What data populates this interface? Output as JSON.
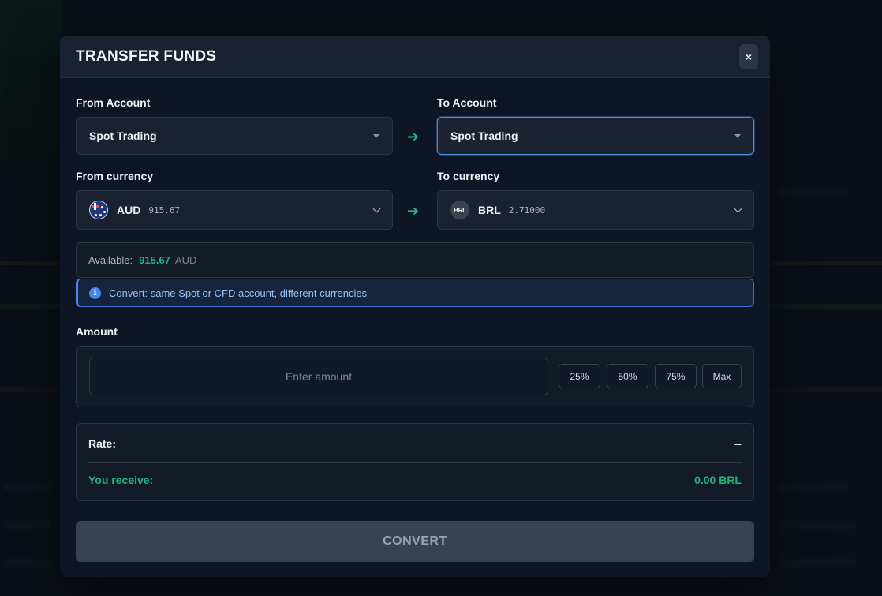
{
  "modal": {
    "title": "TRANSFER FUNDS",
    "close_label": "×"
  },
  "from_account": {
    "label": "From Account",
    "value": "Spot Trading"
  },
  "to_account": {
    "label": "To Account",
    "value": "Spot Trading"
  },
  "from_currency": {
    "label": "From currency",
    "code": "AUD",
    "balance": "915.67",
    "icon": "australia-flag-icon"
  },
  "to_currency": {
    "label": "To currency",
    "code": "BRL",
    "badge": "BRL",
    "balance": "2.71000",
    "icon": "brl-badge-icon"
  },
  "available": {
    "label": "Available:",
    "value": "915.67",
    "currency": "AUD"
  },
  "info": {
    "text": "Convert: same Spot or CFD account, different currencies"
  },
  "amount": {
    "label": "Amount",
    "placeholder": "Enter amount",
    "quick_buttons": [
      "25%",
      "50%",
      "75%",
      "Max"
    ]
  },
  "summary": {
    "rate_label": "Rate:",
    "rate_value": "--",
    "receive_label": "You receive:",
    "receive_value": "0.00 BRL"
  },
  "convert_label": "CONVERT",
  "colors": {
    "accent_green": "#26b27e",
    "info_blue": "#4c86ea",
    "bg_modal": "#0e1524"
  }
}
